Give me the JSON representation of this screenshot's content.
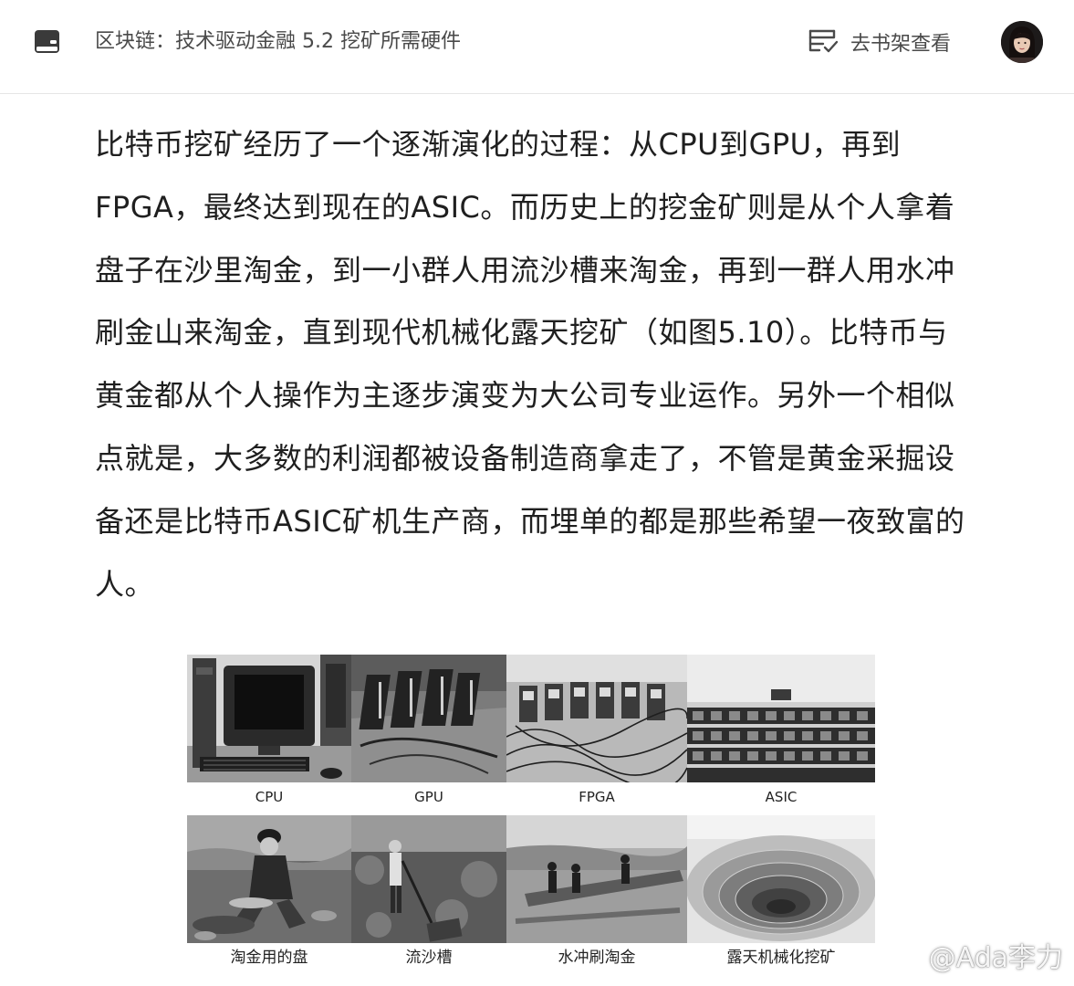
{
  "header": {
    "breadcrumb": "区块链：技术驱动金融 5.2 挖矿所需硬件",
    "shelf_label": "去书架查看",
    "icons": {
      "book": "book-icon",
      "shelf": "bookshelf-icon",
      "avatar": "user-avatar"
    }
  },
  "article": {
    "paragraph": "比特币挖矿经历了一个逐渐演化的过程：从CPU到GPU，再到FPGA，最终达到现在的ASIC。而历史上的挖金矿则是从个人拿着盘子在沙里淘金，到一小群人用流沙槽来淘金，再到一群人用水冲刷金山来淘金，直到现代机械化露天挖矿（如图5.10）。比特币与黄金都从个人操作为主逐步演变为大公司专业运作。另外一个相似点就是，大多数的利润都被设备制造商拿走了，不管是黄金采掘设备还是比特币ASIC矿机生产商，而埋单的都是那些希望一夜致富的人。"
  },
  "figure": {
    "top_captions": [
      "CPU",
      "GPU",
      "FPGA",
      "ASIC"
    ],
    "bottom_captions": [
      "淘金用的盘",
      "流沙槽",
      "水冲刷淘金",
      "露天机械化挖矿"
    ]
  },
  "watermark": {
    "text": "@Ada李力",
    "icon": "weibo-icon"
  },
  "colors": {
    "text": "#1f1f1f",
    "muted": "#4a4a4a",
    "divider": "#e6e6e6"
  }
}
